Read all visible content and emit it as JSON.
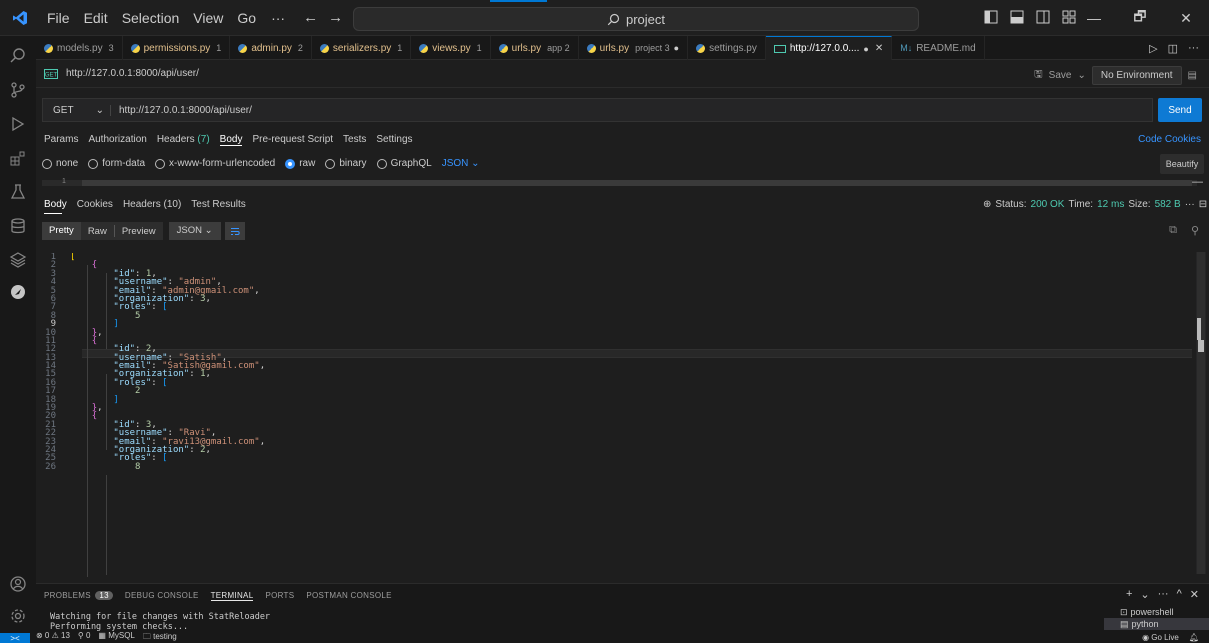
{
  "titlebar": {
    "menu": [
      "File",
      "Edit",
      "Selection",
      "View",
      "Go"
    ],
    "more": "···",
    "back": "←",
    "forward": "→",
    "search_text": "project",
    "win_min": "—",
    "win_max": "🗗",
    "win_close": "✕"
  },
  "tabs": [
    {
      "name": "models.py",
      "badge": "3",
      "modified": false,
      "active": false
    },
    {
      "name": "permissions.py",
      "badge": "1",
      "modified": true,
      "active": false
    },
    {
      "name": "admin.py",
      "badge": "2",
      "modified": true,
      "active": false
    },
    {
      "name": "serializers.py",
      "badge": "1",
      "modified": true,
      "active": false
    },
    {
      "name": "views.py",
      "badge": "1",
      "modified": true,
      "active": false
    },
    {
      "name": "urls.py",
      "badge": "app 2",
      "modified": true,
      "active": false
    },
    {
      "name": "urls.py",
      "badge": "project 3",
      "modified": true,
      "active": false,
      "dot": "●"
    },
    {
      "name": "settings.py",
      "badge": "",
      "modified": false,
      "active": false
    },
    {
      "name": "http://127.0.0....",
      "badge": "",
      "modified": false,
      "active": true,
      "dot": "●",
      "close": "✕"
    },
    {
      "name": "README.md",
      "badge": "",
      "modified": false,
      "active": false
    }
  ],
  "tab_tools": {
    "run": "▷",
    "split": "◫",
    "more": "···"
  },
  "request": {
    "title": "http://127.0.0.1:8000/api/user/",
    "save_label": "Save",
    "environment": "No Environment",
    "method": "GET",
    "url": "http://127.0.0.1:8000/api/user/",
    "send_label": "Send",
    "tabs": [
      {
        "label": "Params",
        "count": ""
      },
      {
        "label": "Authorization",
        "count": ""
      },
      {
        "label": "Headers",
        "count": "(7)"
      },
      {
        "label": "Body",
        "count": ""
      },
      {
        "label": "Pre-request Script",
        "count": ""
      },
      {
        "label": "Tests",
        "count": ""
      },
      {
        "label": "Settings",
        "count": ""
      }
    ],
    "code_label": "Code",
    "cookies_label": "Cookies",
    "body_types": [
      "none",
      "form-data",
      "x-www-form-urlencoded",
      "raw",
      "binary",
      "GraphQL"
    ],
    "body_selected": "raw",
    "body_format": "JSON",
    "beautify_label": "Beautify",
    "editor_line": "1"
  },
  "response": {
    "tabs": [
      "Body",
      "Cookies",
      "Headers (10)",
      "Test Results"
    ],
    "status_label": "Status:",
    "status_value": "200 OK",
    "time_label": "Time:",
    "time_value": "12 ms",
    "size_label": "Size:",
    "size_value": "582 B",
    "views": [
      "Pretty",
      "Raw",
      "Preview"
    ],
    "view_selected": "Pretty",
    "format": "JSON"
  },
  "code_lines": [
    [
      [
        "b1",
        "["
      ]
    ],
    [
      [
        "p",
        "    "
      ],
      [
        "b2",
        "{"
      ]
    ],
    [
      [
        "p",
        "        "
      ],
      [
        "key",
        "\"id\""
      ],
      [
        "p",
        ": "
      ],
      [
        "num",
        "1"
      ],
      [
        "p",
        ","
      ]
    ],
    [
      [
        "p",
        "        "
      ],
      [
        "key",
        "\"username\""
      ],
      [
        "p",
        ": "
      ],
      [
        "str",
        "\"admin\""
      ],
      [
        "p",
        ","
      ]
    ],
    [
      [
        "p",
        "        "
      ],
      [
        "key",
        "\"email\""
      ],
      [
        "p",
        ": "
      ],
      [
        "str",
        "\"admin@gmail.com\""
      ],
      [
        "p",
        ","
      ]
    ],
    [
      [
        "p",
        "        "
      ],
      [
        "key",
        "\"organization\""
      ],
      [
        "p",
        ": "
      ],
      [
        "num",
        "3"
      ],
      [
        "p",
        ","
      ]
    ],
    [
      [
        "p",
        "        "
      ],
      [
        "key",
        "\"roles\""
      ],
      [
        "p",
        ": "
      ],
      [
        "b3",
        "["
      ]
    ],
    [
      [
        "p",
        "            "
      ],
      [
        "num",
        "5"
      ]
    ],
    [
      [
        "p",
        "        "
      ],
      [
        "b3",
        "]"
      ]
    ],
    [
      [
        "p",
        "    "
      ],
      [
        "b2",
        "}"
      ],
      [
        "p",
        ","
      ]
    ],
    [
      [
        "p",
        "    "
      ],
      [
        "b2",
        "{"
      ]
    ],
    [
      [
        "p",
        "        "
      ],
      [
        "key",
        "\"id\""
      ],
      [
        "p",
        ": "
      ],
      [
        "num",
        "2"
      ],
      [
        "p",
        ","
      ]
    ],
    [
      [
        "p",
        "        "
      ],
      [
        "key",
        "\"username\""
      ],
      [
        "p",
        ": "
      ],
      [
        "str",
        "\"Satish\""
      ],
      [
        "p",
        ","
      ]
    ],
    [
      [
        "p",
        "        "
      ],
      [
        "key",
        "\"email\""
      ],
      [
        "p",
        ": "
      ],
      [
        "str",
        "\"Satish@gamil.com\""
      ],
      [
        "p",
        ","
      ]
    ],
    [
      [
        "p",
        "        "
      ],
      [
        "key",
        "\"organization\""
      ],
      [
        "p",
        ": "
      ],
      [
        "num",
        "1"
      ],
      [
        "p",
        ","
      ]
    ],
    [
      [
        "p",
        "        "
      ],
      [
        "key",
        "\"roles\""
      ],
      [
        "p",
        ": "
      ],
      [
        "b3",
        "["
      ]
    ],
    [
      [
        "p",
        "            "
      ],
      [
        "num",
        "2"
      ]
    ],
    [
      [
        "p",
        "        "
      ],
      [
        "b3",
        "]"
      ]
    ],
    [
      [
        "p",
        "    "
      ],
      [
        "b2",
        "}"
      ],
      [
        "p",
        ","
      ]
    ],
    [
      [
        "p",
        "    "
      ],
      [
        "b2",
        "{"
      ]
    ],
    [
      [
        "p",
        "        "
      ],
      [
        "key",
        "\"id\""
      ],
      [
        "p",
        ": "
      ],
      [
        "num",
        "3"
      ],
      [
        "p",
        ","
      ]
    ],
    [
      [
        "p",
        "        "
      ],
      [
        "key",
        "\"username\""
      ],
      [
        "p",
        ": "
      ],
      [
        "str",
        "\"Ravi\""
      ],
      [
        "p",
        ","
      ]
    ],
    [
      [
        "p",
        "        "
      ],
      [
        "key",
        "\"email\""
      ],
      [
        "p",
        ": "
      ],
      [
        "str",
        "\"ravi13@gmail.com\""
      ],
      [
        "p",
        ","
      ]
    ],
    [
      [
        "p",
        "        "
      ],
      [
        "key",
        "\"organization\""
      ],
      [
        "p",
        ": "
      ],
      [
        "num",
        "2"
      ],
      [
        "p",
        ","
      ]
    ],
    [
      [
        "p",
        "        "
      ],
      [
        "key",
        "\"roles\""
      ],
      [
        "p",
        ": "
      ],
      [
        "b3",
        "["
      ]
    ],
    [
      [
        "p",
        "            "
      ],
      [
        "num",
        "8"
      ]
    ]
  ],
  "panel": {
    "tabs": [
      "PROBLEMS",
      "DEBUG CONSOLE",
      "TERMINAL",
      "PORTS",
      "POSTMAN CONSOLE"
    ],
    "active_tab": "TERMINAL",
    "problems_count": "13",
    "terminal_text": "Watching for file changes with StatReloader\nPerforming system checks...",
    "terminals": [
      "powershell",
      "python"
    ],
    "terminal_selected": "python",
    "tools": [
      "+",
      "⌄",
      "···",
      "^",
      "✕"
    ]
  },
  "statusbar": {
    "remote": "><",
    "errors": "⊗ 0 ⚠ 13",
    "ports": "⚲ 0",
    "db": "MySQL",
    "folder": "testing",
    "golive": "Go Live",
    "bell": "🔔"
  },
  "colors": {
    "accent": "#0078d4",
    "send": "#0e7ad4",
    "ok": "#4ec9b0",
    "link": "#3794ff"
  }
}
